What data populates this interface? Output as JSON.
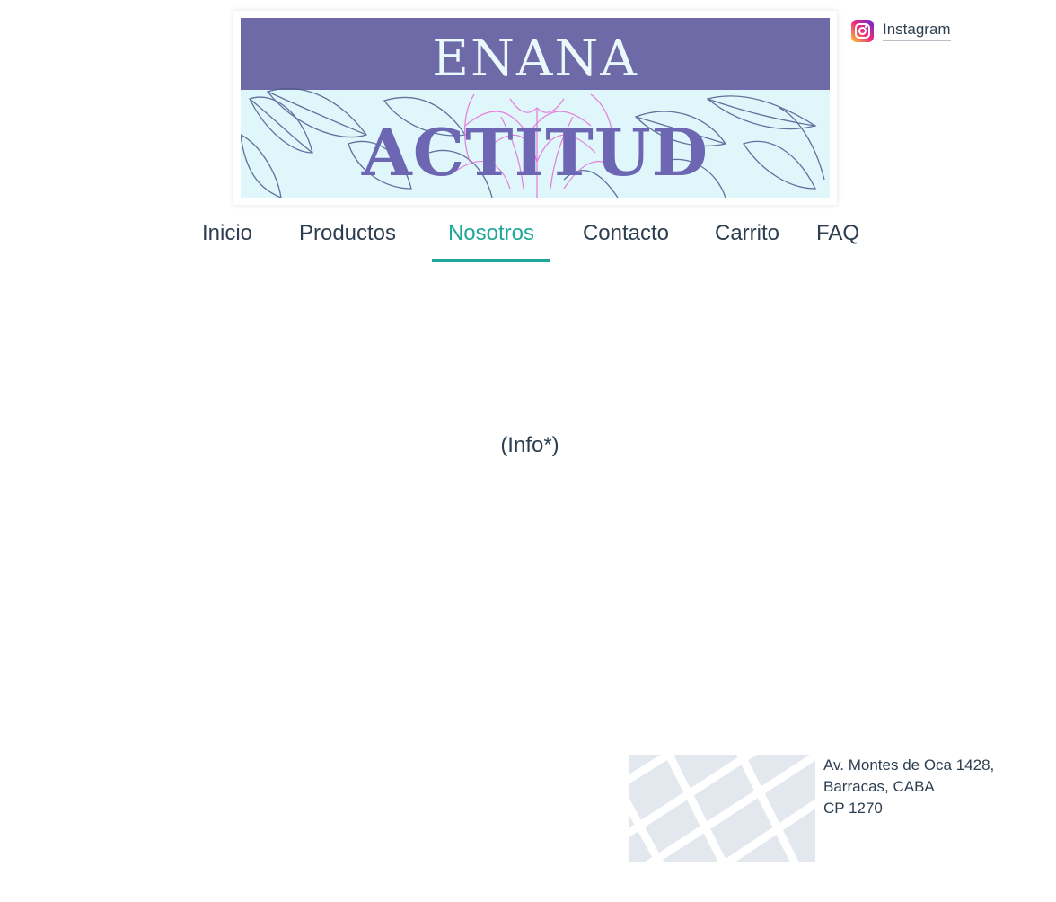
{
  "header": {
    "brand": {
      "line1": "ENANA",
      "line2": "ACTITUD",
      "colors": {
        "top_band": "#6e69a7",
        "background": "#dff6fb",
        "line1_text": "#e9f8fb",
        "line2_text": "#6d66b3",
        "leaf_outline": "#4b5a8c",
        "flower_outline": "#e86fd6"
      }
    },
    "social": {
      "label": "Instagram",
      "icon": "instagram-icon"
    }
  },
  "nav": {
    "items": [
      {
        "label": "Inicio",
        "active": false
      },
      {
        "label": "Productos",
        "active": false
      },
      {
        "label": "Nosotros",
        "active": true
      },
      {
        "label": "Contacto",
        "active": false
      },
      {
        "label": "Carrito",
        "active": false
      },
      {
        "label": "FAQ",
        "active": false
      }
    ],
    "colors": {
      "text": "#2d3e50",
      "active": "#1fa89a"
    }
  },
  "main": {
    "info_text": "(Info*)"
  },
  "footer": {
    "address": {
      "line1": "Av. Montes de Oca 1428,",
      "line2": "Barracas, CABA",
      "line3": "CP 1270"
    },
    "map_icon": "map-thumbnail"
  }
}
